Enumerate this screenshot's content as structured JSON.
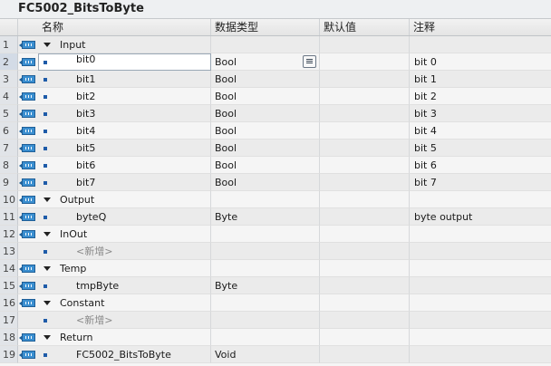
{
  "window": {
    "title": "FC5002_BitsToByte"
  },
  "header": {
    "name": "名称",
    "datatype": "数据类型",
    "default": "默认值",
    "comment": "注释"
  },
  "rows": [
    {
      "num": "1",
      "name": "Input",
      "kind": "section",
      "type": "",
      "comment": ""
    },
    {
      "num": "2",
      "name": "bit0",
      "kind": "var",
      "type": "Bool",
      "comment": "bit 0"
    },
    {
      "num": "3",
      "name": "bit1",
      "kind": "var",
      "type": "Bool",
      "comment": "bit 1"
    },
    {
      "num": "4",
      "name": "bit2",
      "kind": "var",
      "type": "Bool",
      "comment": "bit 2"
    },
    {
      "num": "5",
      "name": "bit3",
      "kind": "var",
      "type": "Bool",
      "comment": "bit 3"
    },
    {
      "num": "6",
      "name": "bit4",
      "kind": "var",
      "type": "Bool",
      "comment": "bit 4"
    },
    {
      "num": "7",
      "name": "bit5",
      "kind": "var",
      "type": "Bool",
      "comment": "bit 5"
    },
    {
      "num": "8",
      "name": "bit6",
      "kind": "var",
      "type": "Bool",
      "comment": "bit 6"
    },
    {
      "num": "9",
      "name": "bit7",
      "kind": "var",
      "type": "Bool",
      "comment": "bit 7"
    },
    {
      "num": "10",
      "name": "Output",
      "kind": "section",
      "type": "",
      "comment": ""
    },
    {
      "num": "11",
      "name": "byteQ",
      "kind": "var",
      "type": "Byte",
      "comment": "byte output"
    },
    {
      "num": "12",
      "name": "InOut",
      "kind": "section",
      "type": "",
      "comment": ""
    },
    {
      "num": "13",
      "name": "<新增>",
      "kind": "add",
      "type": "",
      "comment": ""
    },
    {
      "num": "14",
      "name": "Temp",
      "kind": "section",
      "type": "",
      "comment": ""
    },
    {
      "num": "15",
      "name": "tmpByte",
      "kind": "var",
      "type": "Byte",
      "comment": ""
    },
    {
      "num": "16",
      "name": "Constant",
      "kind": "section",
      "type": "",
      "comment": ""
    },
    {
      "num": "17",
      "name": "<新增>",
      "kind": "add",
      "type": "",
      "comment": ""
    },
    {
      "num": "18",
      "name": "Return",
      "kind": "section",
      "type": "",
      "comment": ""
    },
    {
      "num": "19",
      "name": "FC5002_BitsToByte",
      "kind": "var",
      "type": "Void",
      "comment": ""
    }
  ],
  "icons": {
    "interface": "interface-parameter-icon",
    "expand": "expand-triangle-icon",
    "bullet": "parameter-bullet-icon",
    "dropdown": "datatype-dropdown-icon"
  },
  "colors": {
    "accent": "#1e5ba8",
    "interface_icon": "#3b8fd0"
  }
}
